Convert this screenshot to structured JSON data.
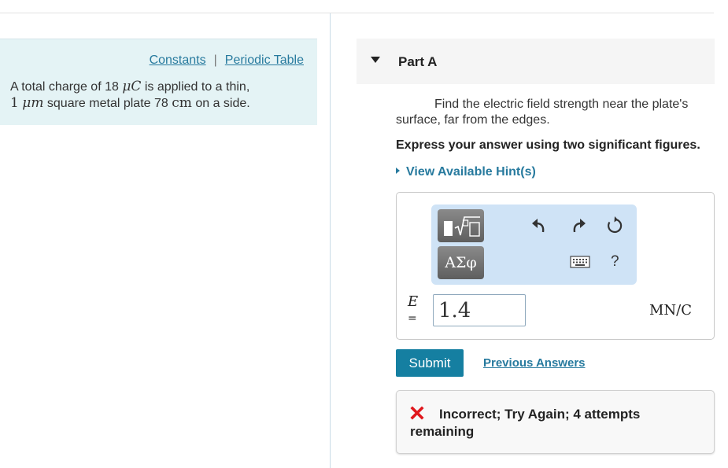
{
  "info": {
    "constants_link": "Constants",
    "separator": "|",
    "periodic_link": "Periodic Table",
    "problem_part1": "A total charge of 18 ",
    "charge_unit": "μC",
    "problem_part2": " is applied to a thin,",
    "thickness_num": "1",
    "thickness_unit": "μm",
    "problem_part3": " square metal plate 78 ",
    "side_unit": "cm",
    "problem_part4": " on a side."
  },
  "part": {
    "title": "Part A",
    "question": "Find the electric field strength near the plate's surface, far from the edges.",
    "instruction": "Express your answer using two significant figures.",
    "hint_link": "View Available Hint(s)"
  },
  "toolbar": {
    "symbols_label": "ΑΣφ",
    "help_label": "?"
  },
  "answer": {
    "variable": "E",
    "equals": "=",
    "value": "1.4",
    "units": "MN/C"
  },
  "actions": {
    "submit_label": "Submit",
    "previous_answers_label": "Previous Answers"
  },
  "feedback": {
    "message": "Incorrect; Try Again; 4 attempts remaining",
    "status_color": "#e0171c"
  },
  "colors": {
    "accent": "#157fa1",
    "link": "#277a9e",
    "info_panel_bg": "#e4f3f5",
    "toolbar_bg": "#cfe3f6"
  }
}
